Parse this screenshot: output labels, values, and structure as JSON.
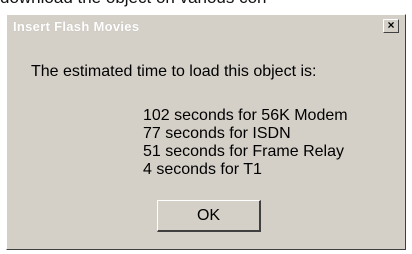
{
  "caption_fragment": "download the object on various con",
  "dialog": {
    "title": "Insert Flash Movies",
    "close_label": "×",
    "message": "The estimated time to load this object is:",
    "lines": [
      "102 seconds for 56K Modem",
      "77 seconds for ISDN",
      "51 seconds for Frame Relay",
      "4 seconds for T1"
    ],
    "ok_label": "OK"
  }
}
